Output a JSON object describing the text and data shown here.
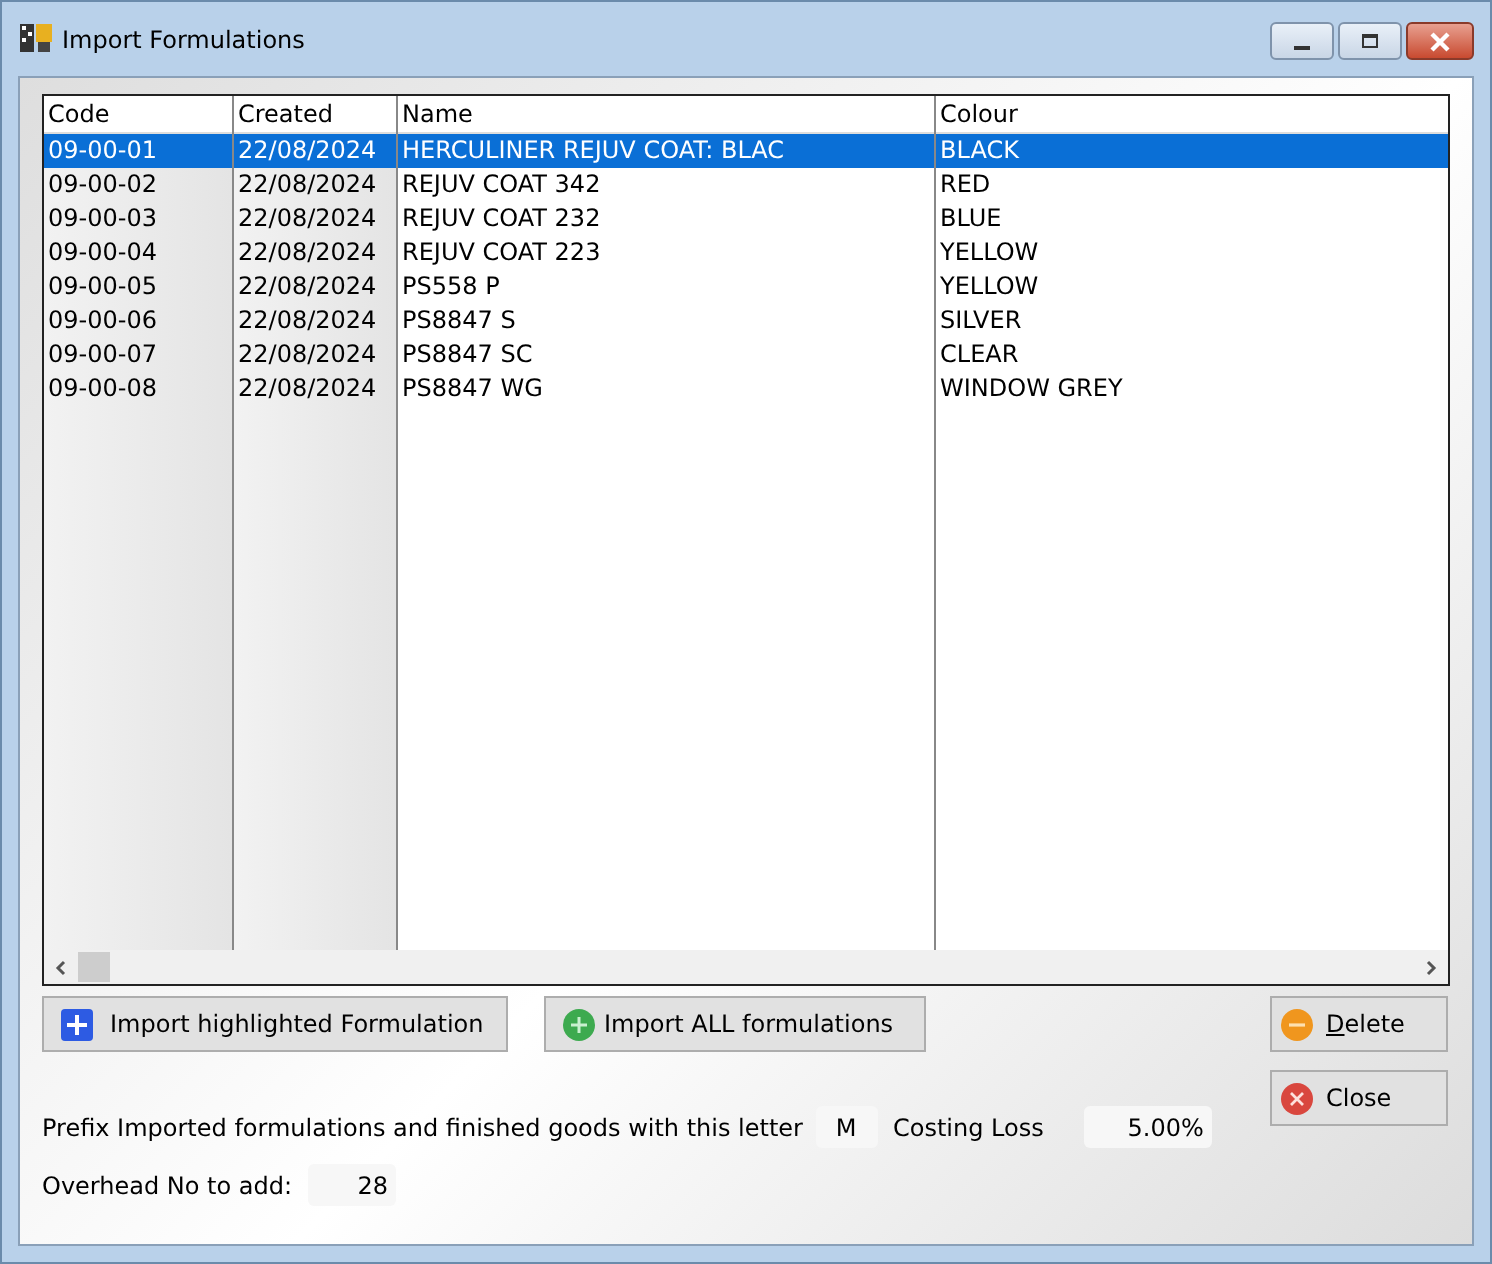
{
  "window": {
    "title": "Import Formulations"
  },
  "table": {
    "columns": [
      "Code",
      "Created",
      "Name",
      "Colour"
    ],
    "rows": [
      {
        "cells": [
          "09-00-01",
          "22/08/2024",
          "HERCULINER REJUV COAT: BLAC",
          "BLACK"
        ],
        "selected": true
      },
      {
        "cells": [
          "09-00-02",
          "22/08/2024",
          "REJUV COAT 342",
          "RED"
        ],
        "selected": false
      },
      {
        "cells": [
          "09-00-03",
          "22/08/2024",
          "REJUV COAT 232",
          "BLUE"
        ],
        "selected": false
      },
      {
        "cells": [
          "09-00-04",
          "22/08/2024",
          "REJUV COAT 223",
          "YELLOW"
        ],
        "selected": false
      },
      {
        "cells": [
          "09-00-05",
          "22/08/2024",
          "PS558 P",
          "YELLOW"
        ],
        "selected": false
      },
      {
        "cells": [
          "09-00-06",
          "22/08/2024",
          "PS8847 S",
          "SILVER"
        ],
        "selected": false
      },
      {
        "cells": [
          "09-00-07",
          "22/08/2024",
          "PS8847 SC",
          "CLEAR"
        ],
        "selected": false
      },
      {
        "cells": [
          "09-00-08",
          "22/08/2024",
          "PS8847 WG",
          "WINDOW GREY"
        ],
        "selected": false
      }
    ]
  },
  "buttons": [
    {
      "label": "Import highlighted Formulation",
      "kind": "add-square"
    },
    {
      "label": "Import ALL formulations",
      "kind": "add-circle"
    }
  ],
  "side_buttons": [
    {
      "label": "Delete",
      "kind": "delete"
    },
    {
      "label": "Close",
      "kind": "close"
    }
  ],
  "prefix": {
    "label": "Prefix Imported formulations and finished goods with this letter",
    "value": "M"
  },
  "costing_loss": {
    "label": "Costing Loss",
    "value": "5.00%"
  },
  "overhead": {
    "label": "Overhead No to add:",
    "value": "28"
  }
}
